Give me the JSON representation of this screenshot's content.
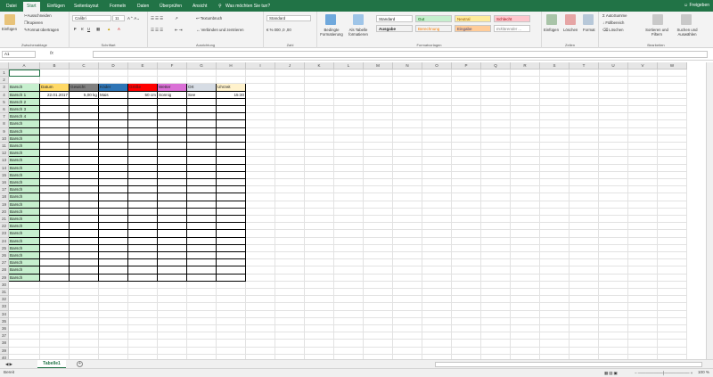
{
  "tabs": [
    "Datei",
    "Start",
    "Einfügen",
    "Seitenlayout",
    "Formeln",
    "Daten",
    "Überprüfen",
    "Ansicht"
  ],
  "tell_me": "Was möchten Sie tun?",
  "share": "Freigeben",
  "clipboard": {
    "paste": "Einfügen",
    "cut": "Ausschneiden",
    "copy": "Kopieren",
    "format_painter": "Format übertragen",
    "label": "Zwischenablage"
  },
  "font": {
    "name": "Calibri",
    "size": "11",
    "label": "Schriftart",
    "bold": "F",
    "italic": "K",
    "underline": "U"
  },
  "alignment": {
    "wrap": "Textumbruch",
    "merge": "Verbinden und zentrieren",
    "label": "Ausrichtung"
  },
  "number": {
    "format": "Standard",
    "label": "Zahl"
  },
  "styles": {
    "conditional": "Bedingte Formatierung",
    "table": "Als Tabelle formatieren",
    "items": [
      "Standard",
      "Gut",
      "Neutral",
      "Schlecht",
      "Ausgabe",
      "Berechnung",
      "Eingabe",
      "Erklärender ..."
    ],
    "label": "Formatvorlagen"
  },
  "cells": {
    "insert": "Einfügen",
    "delete": "Löschen",
    "format": "Format",
    "label": "Zellen"
  },
  "editing": {
    "autosum": "AutoSumme",
    "fill": "Füllbereich",
    "clear": "Löschen",
    "sort": "Sortieren und Filtern",
    "find": "Suchen und Auswählen",
    "label": "Bearbeiten"
  },
  "formula_bar": {
    "name_box": "A1",
    "fx": "fx",
    "value": ""
  },
  "columns": [
    "A",
    "B",
    "C",
    "D",
    "E",
    "F",
    "G",
    "H",
    "I",
    "J",
    "K",
    "L",
    "M",
    "N",
    "O",
    "P",
    "Q",
    "R",
    "S",
    "T",
    "U",
    "V",
    "W"
  ],
  "rows": [
    "1",
    "2",
    "3",
    "4",
    "5",
    "6",
    "7",
    "8",
    "9",
    "10",
    "11",
    "12",
    "13",
    "14",
    "15",
    "16",
    "17",
    "18",
    "19",
    "20",
    "21",
    "22",
    "23",
    "24",
    "25",
    "26",
    "27",
    "28",
    "29",
    "30",
    "31",
    "32",
    "33",
    "34",
    "35",
    "36",
    "37",
    "38",
    "39",
    "40"
  ],
  "table_headers": [
    {
      "text": "Datum",
      "color": "#ffd966"
    },
    {
      "text": "Gewicht",
      "color": "#808080"
    },
    {
      "text": "Köder",
      "color": "#2e75b6"
    },
    {
      "text": "Größe",
      "color": "#ff0000"
    },
    {
      "text": "Wetter",
      "color": "#da70d6"
    },
    {
      "text": "Ort",
      "color": "#d6dce4"
    },
    {
      "text": "Uhrzeit",
      "color": "#fff2cc"
    }
  ],
  "first_row": [
    "22.01.2017",
    "5,00 kg",
    "Mais",
    "50 cm",
    "Sonnig",
    "See",
    "15:30"
  ],
  "fish_label": "Barsch",
  "fish_rows": [
    "Barsch 1",
    "Barsch 2",
    "Barsch 3",
    "Barsch 4",
    "Barsch",
    "Barsch",
    "Barsch",
    "Barsch",
    "Barsch",
    "Barsch",
    "Barsch",
    "Barsch",
    "Barsch",
    "Barsch",
    "Barsch",
    "Barsch",
    "Barsch",
    "Barsch",
    "Barsch",
    "Barsch",
    "Barsch",
    "Barsch",
    "Barsch",
    "Barsch",
    "Barsch",
    "Barsch"
  ],
  "sheet_tab": "Tabelle1",
  "status": "Bereit",
  "zoom": "100 %",
  "colors": {
    "accent": "#217346",
    "fish_col": "#c6efce"
  }
}
